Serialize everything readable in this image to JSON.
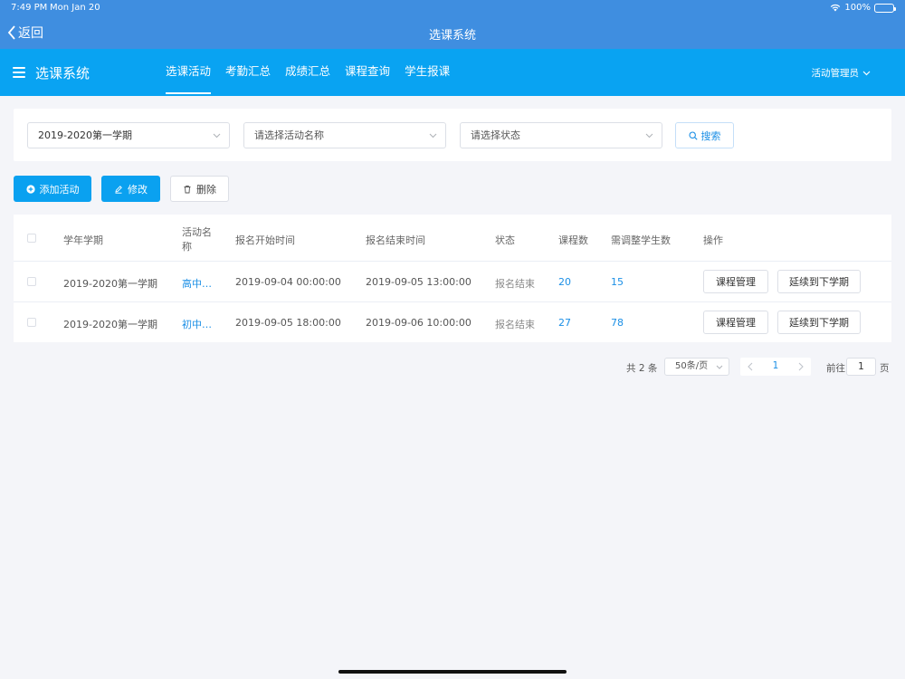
{
  "status_bar": {
    "time": "7:49 PM",
    "date": "Mon Jan 20",
    "battery": "100%"
  },
  "nav": {
    "back_label": "返回",
    "title": "选课系统"
  },
  "header": {
    "brand": "选课系统",
    "tabs": [
      {
        "label": "选课活动",
        "active": true
      },
      {
        "label": "考勤汇总",
        "active": false
      },
      {
        "label": "成绩汇总",
        "active": false
      },
      {
        "label": "课程查询",
        "active": false
      },
      {
        "label": "学生报课",
        "active": false
      }
    ],
    "user": "活动管理员"
  },
  "filters": {
    "term_value": "2019-2020第一学期",
    "activity_placeholder": "请选择活动名称",
    "status_placeholder": "请选择状态",
    "search_label": "搜索"
  },
  "actions": {
    "add": "添加活动",
    "edit": "修改",
    "delete": "删除"
  },
  "table": {
    "headers": {
      "term": "学年学期",
      "name_line1": "活动名",
      "name_line2": "称",
      "start": "报名开始时间",
      "end": "报名结束时间",
      "status": "状态",
      "courses": "课程数",
      "adjust": "需调整学生数",
      "ops": "操作"
    },
    "rows": [
      {
        "term": "2019-2020第一学期",
        "name": "高中…",
        "start": "2019-09-04 00:00:00",
        "end": "2019-09-05 13:00:00",
        "status": "报名结束",
        "courses": "20",
        "adjust": "15"
      },
      {
        "term": "2019-2020第一学期",
        "name": "初中…",
        "start": "2019-09-05 18:00:00",
        "end": "2019-09-06 10:00:00",
        "status": "报名结束",
        "courses": "27",
        "adjust": "78"
      }
    ],
    "row_actions": {
      "manage": "课程管理",
      "extend": "延续到下学期"
    }
  },
  "pagination": {
    "total": "共 2 条",
    "page_size": "50条/页",
    "current_page": "1",
    "goto_label": "前往",
    "goto_value": "1",
    "goto_suffix": "页"
  },
  "colors": {
    "nav_bar": "#3f8ee0",
    "header": "#09a3f2",
    "accent": "#1b8fe6"
  }
}
